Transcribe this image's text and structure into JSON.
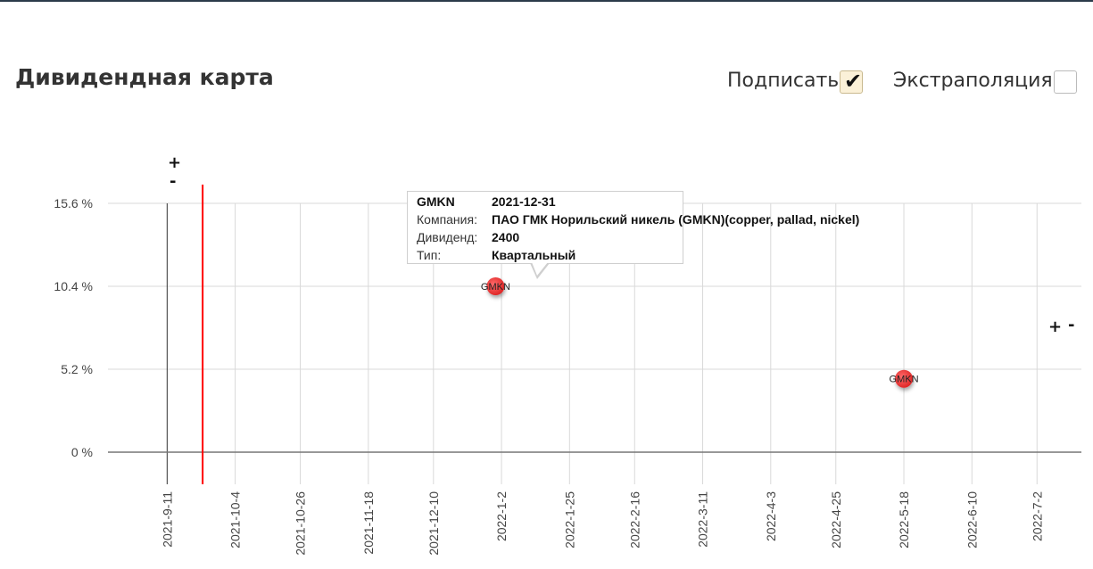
{
  "title": "Дивидендная карта",
  "options": {
    "sign_label": "Подписать",
    "sign_checked": true,
    "extrapolation_label": "Экстраполяция",
    "extrapolation_checked": false
  },
  "zoom": {
    "plus": "+",
    "minus": "-"
  },
  "tooltip": {
    "ticker": "GMKN",
    "date": "2021-12-31",
    "company_label": "Компания:",
    "company_value": "ПАО ГМК Норильский никель (GMKN)(copper, pallad, nickel)",
    "dividend_label": "Дивиденд:",
    "dividend_value": "2400",
    "type_label": "Тип:",
    "type_value": "Квартальный"
  },
  "chart_data": {
    "type": "scatter",
    "title": "Дивидендная карта",
    "xlabel": "",
    "ylabel": "",
    "yticks": [
      "0 %",
      "5.2 %",
      "10.4 %",
      "15.6 %"
    ],
    "ytick_values": [
      0,
      5.2,
      10.4,
      15.6
    ],
    "ylim": [
      -2,
      15.6
    ],
    "xticks": [
      "2021-9-11",
      "2021-10-4",
      "2021-10-26",
      "2021-11-18",
      "2021-12-10",
      "2022-1-2",
      "2022-1-25",
      "2022-2-16",
      "2022-3-11",
      "2022-4-3",
      "2022-4-25",
      "2022-5-18",
      "2022-6-10",
      "2022-7-2"
    ],
    "xlim": [
      "2021-8-22",
      "2022-7-17"
    ],
    "today_marker": "2021-9-23",
    "today_marker_color": "#ff0000",
    "point_color": "#f04040",
    "grid": true,
    "points": [
      {
        "label": "GMKN",
        "x": "2021-12-31",
        "y": 10.4
      },
      {
        "label": "GMKN",
        "x": "2022-5-18",
        "y": 4.6
      }
    ]
  }
}
